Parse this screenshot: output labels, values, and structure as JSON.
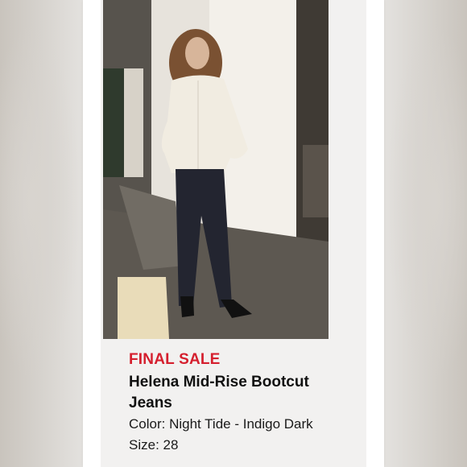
{
  "listing": {
    "tag": "FINAL SALE",
    "title_line1": "Helena Mid-Rise Bootcut",
    "title_line2": "Jeans",
    "color_line": "Color: Night Tide - Indigo Dark",
    "size_line": "Size: 28"
  },
  "photo": {
    "subject": "model-wearing-bootcut-jeans"
  },
  "colors": {
    "sale_red": "#d51f2e",
    "text_dark": "#111111",
    "card_bg": "#ffffff",
    "panel_bg": "#f2f1f0"
  }
}
